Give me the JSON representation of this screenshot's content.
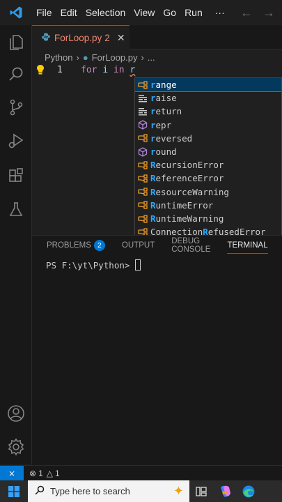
{
  "menu": [
    "File",
    "Edit",
    "Selection",
    "View",
    "Go",
    "Run",
    "···"
  ],
  "tab": {
    "filename": "ForLoop.py",
    "problems": "2"
  },
  "breadcrumb": {
    "folder": "Python",
    "file": "ForLoop.py",
    "more": "..."
  },
  "editor": {
    "line_number": "1",
    "kw_for": "for",
    "var": "i",
    "kw_in": "in",
    "typed": "r"
  },
  "suggestions": [
    {
      "icon": "class",
      "label": "range",
      "selected": true
    },
    {
      "icon": "keyword",
      "label": "raise"
    },
    {
      "icon": "keyword",
      "label": "return"
    },
    {
      "icon": "function",
      "label": "repr"
    },
    {
      "icon": "class",
      "label": "reversed"
    },
    {
      "icon": "function",
      "label": "round"
    },
    {
      "icon": "class",
      "label": "RecursionError"
    },
    {
      "icon": "class",
      "label": "ReferenceError"
    },
    {
      "icon": "class",
      "label": "ResourceWarning"
    },
    {
      "icon": "class",
      "label": "RuntimeError"
    },
    {
      "icon": "class",
      "label": "RuntimeWarning"
    },
    {
      "icon": "class",
      "label": "ConnectionRefusedError"
    }
  ],
  "panel": {
    "tabs": [
      "PROBLEMS",
      "OUTPUT",
      "DEBUG CONSOLE",
      "TERMINAL"
    ],
    "problems_badge": "2",
    "prompt": "PS F:\\yt\\Python>"
  },
  "status": {
    "errors": "1",
    "warnings": "1"
  },
  "taskbar": {
    "search_placeholder": "Type here to search"
  },
  "colors": {
    "accent": "#0078d4",
    "error": "#f48771",
    "class_icon": "#ee9d28",
    "function_icon": "#b180d7"
  }
}
